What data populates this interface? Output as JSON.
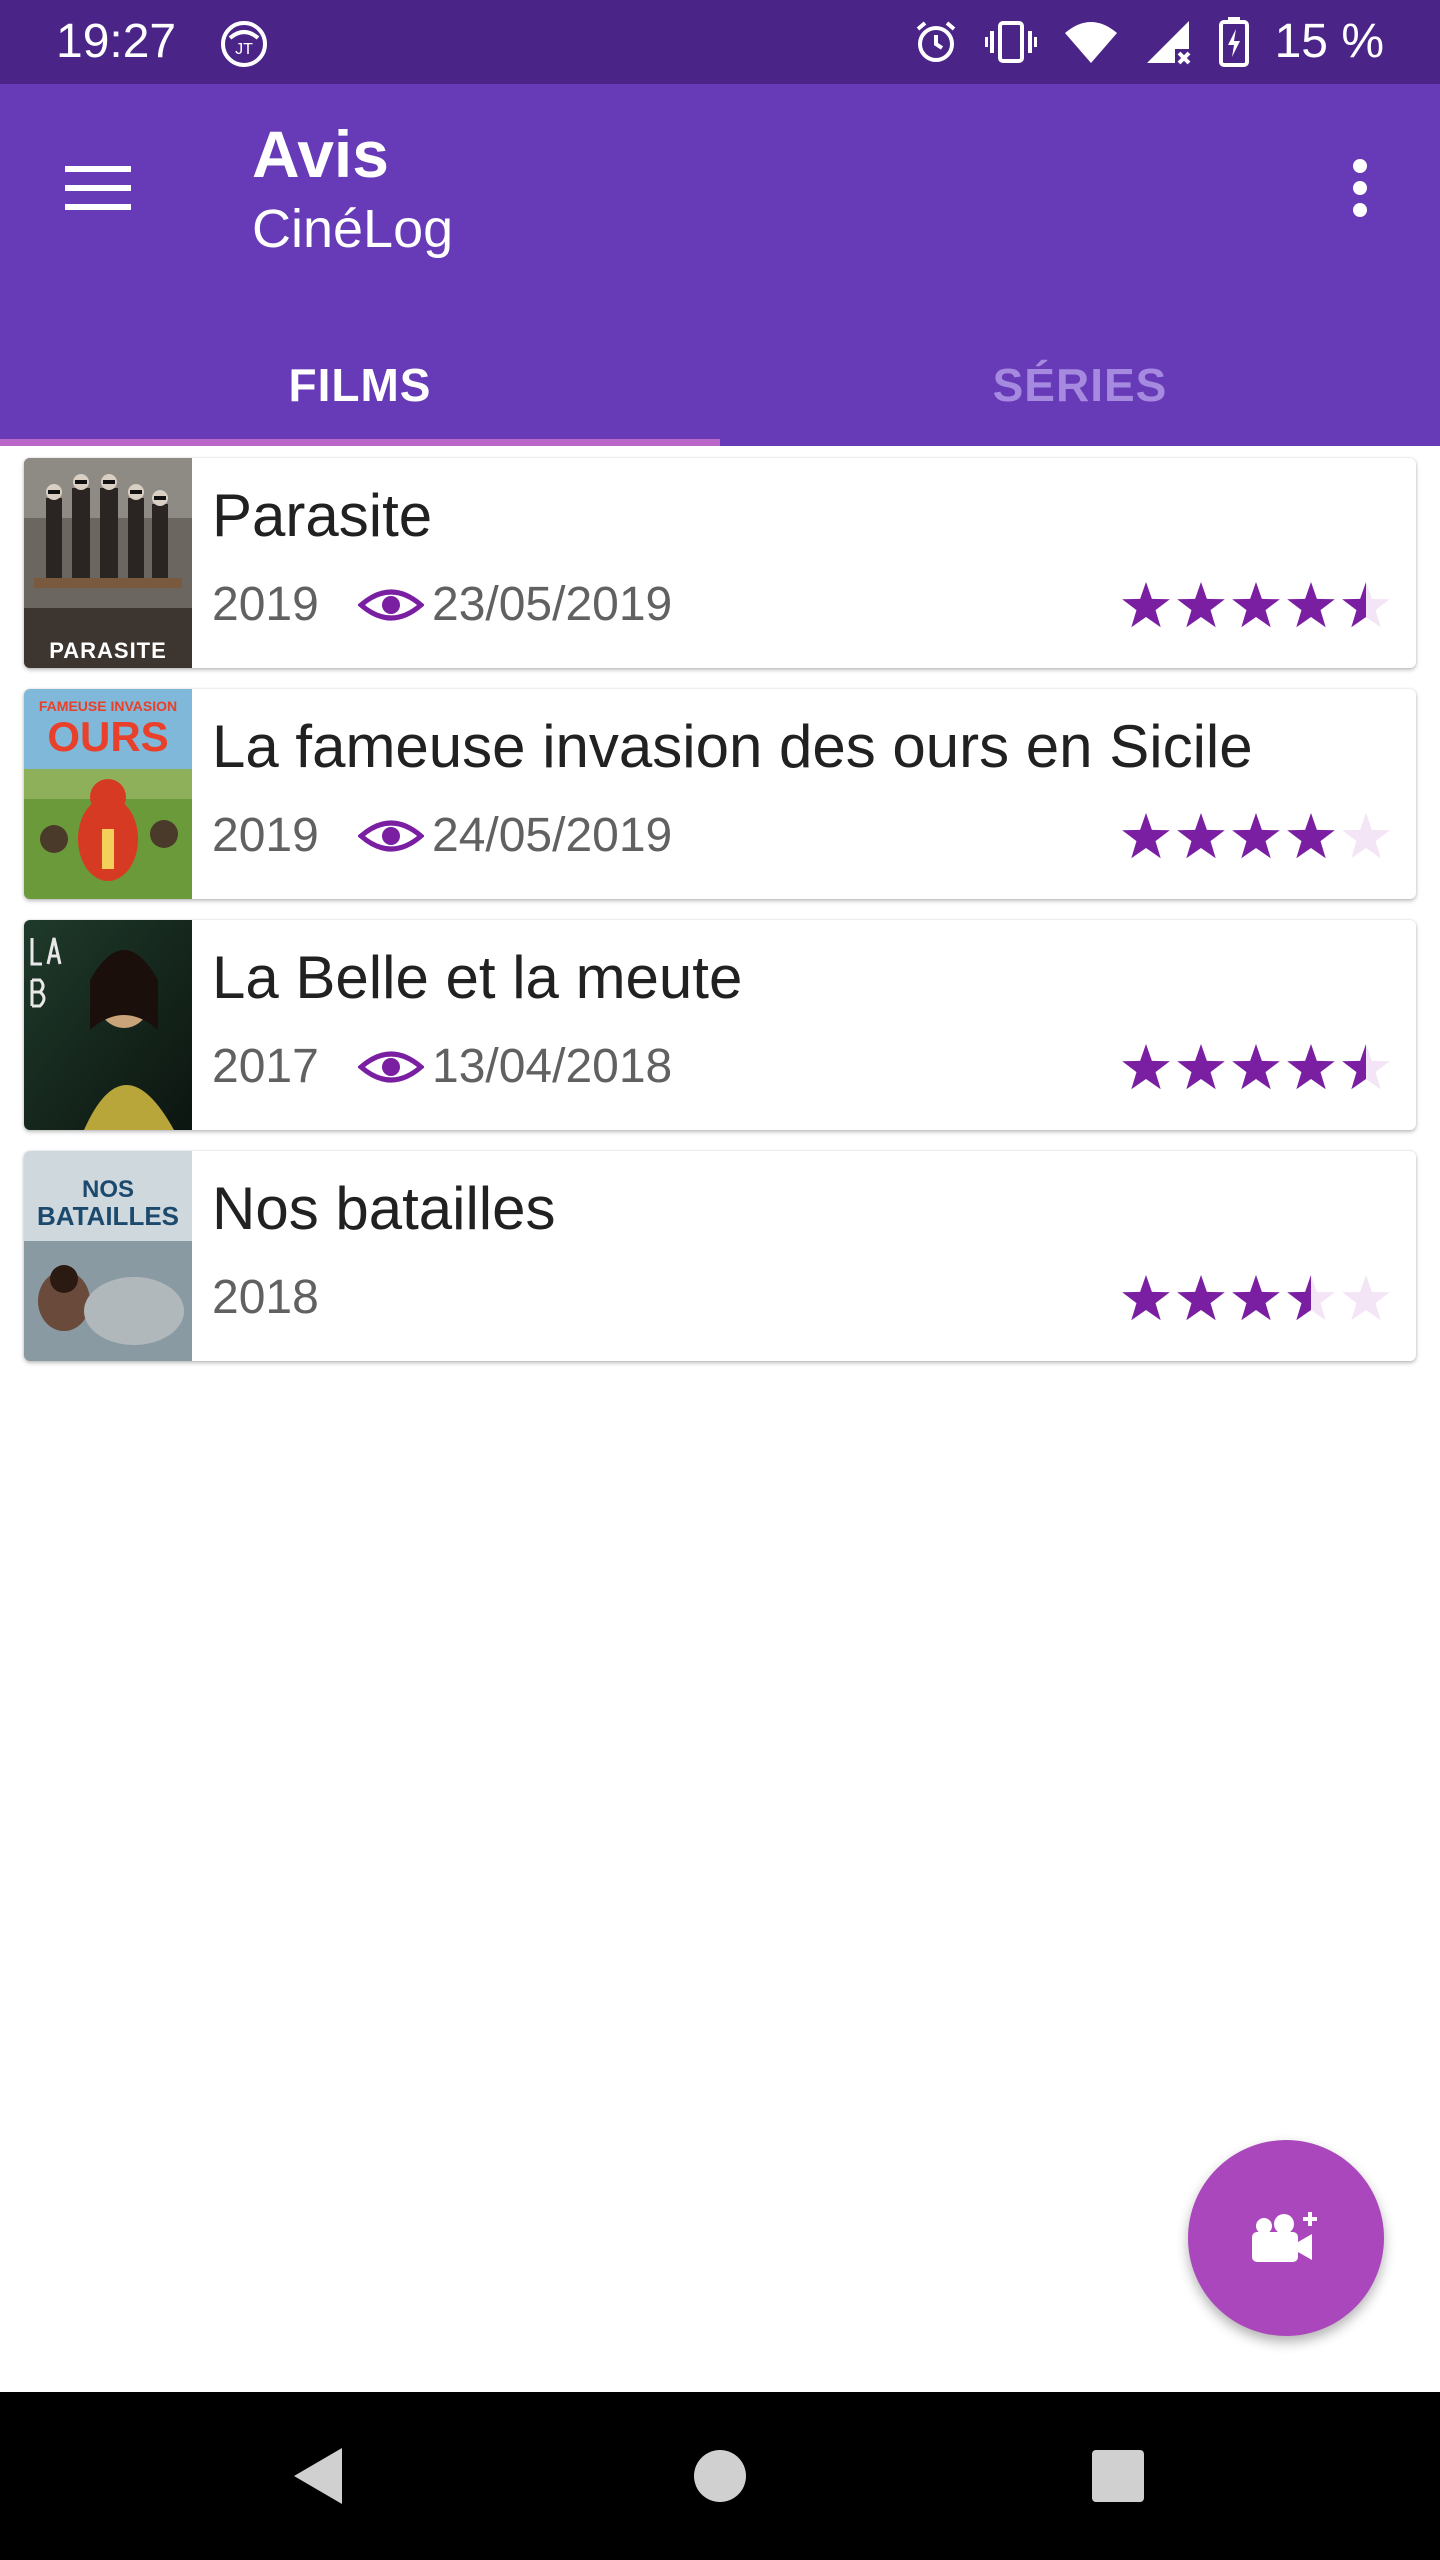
{
  "status_bar": {
    "time": "19:27",
    "battery": "15 %",
    "icons": [
      "notification-app-icon",
      "alarm-icon",
      "vibrate-icon",
      "wifi-icon",
      "signal-icon",
      "battery-icon"
    ]
  },
  "app_bar": {
    "title": "Avis",
    "subtitle": "CinéLog",
    "menu_icon": "menu-icon",
    "overflow_icon": "more-vert-icon"
  },
  "tabs": [
    {
      "label": "FILMS",
      "active": true
    },
    {
      "label": "SÉRIES",
      "active": false
    }
  ],
  "movies": [
    {
      "title": "Parasite",
      "year": "2019",
      "watched_date": "23/05/2019",
      "rating": 4.5,
      "poster_text": "PARASITE"
    },
    {
      "title": "La fameuse invasion des ours en Sicile",
      "year": "2019",
      "watched_date": "24/05/2019",
      "rating": 4,
      "poster_text": ""
    },
    {
      "title": "La Belle et la meute",
      "year": "2017",
      "watched_date": "13/04/2018",
      "rating": 4.5,
      "poster_text": ""
    },
    {
      "title": "Nos batailles",
      "year": "2018",
      "watched_date": null,
      "rating": 3.5,
      "poster_text": ""
    }
  ],
  "rating_max": 5,
  "fab": {
    "icon": "add-video-camera-icon"
  },
  "colors": {
    "status_bar": "#4a2487",
    "app_bar": "#673ab7",
    "tab_indicator": "#ba68c8",
    "star_filled": "#7b1fa2",
    "star_empty": "#f3e5f5",
    "fab": "#ab47bc"
  },
  "nav_bar": {
    "buttons": [
      "back-icon",
      "home-icon",
      "recents-icon"
    ]
  }
}
